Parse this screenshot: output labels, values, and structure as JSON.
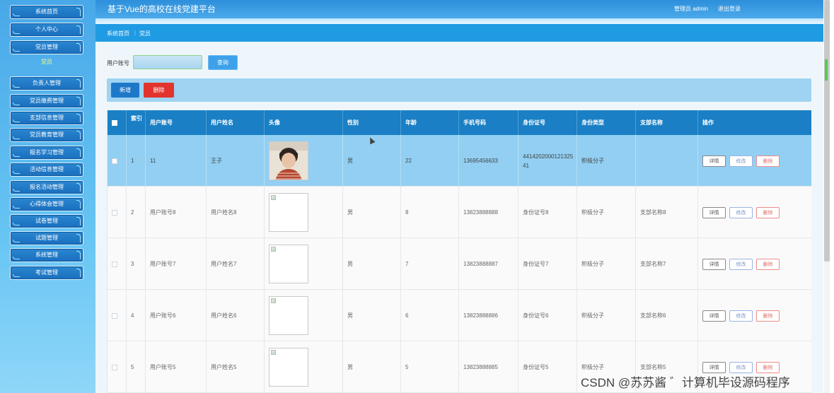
{
  "app": {
    "title": "基于Vue的高校在线党建平台"
  },
  "header": {
    "user_label": "管理员 admin",
    "logout_label": "退出登录"
  },
  "sidebar": {
    "items": [
      "系统首页",
      "个人中心",
      "党员管理",
      "负责人管理",
      "党员缴费管理",
      "支部信息管理",
      "党员教育管理",
      "报名学习管理",
      "活动信息管理",
      "报名活动管理",
      "心得体会管理",
      "试卷管理",
      "试题管理",
      "系统管理",
      "考试管理"
    ],
    "sub_item": "党员"
  },
  "breadcrumb": {
    "home": "系统首页",
    "separator": "⋮",
    "current": "党员"
  },
  "search": {
    "label": "用户账号",
    "value": "",
    "query_label": "查询"
  },
  "actions": {
    "add_label": "新增",
    "delete_label": "删除"
  },
  "table": {
    "columns": [
      "索引",
      "用户账号",
      "用户姓名",
      "头像",
      "性别",
      "年龄",
      "手机号码",
      "身份证号",
      "身份类型",
      "支部名称",
      "操作"
    ],
    "buttons": {
      "detail": "详情",
      "edit": "修改",
      "remove": "删除"
    },
    "rows": [
      {
        "index": "1",
        "account": "11",
        "name": "王子",
        "avatar": "photo",
        "gender": "男",
        "age": "22",
        "phone": "13695456633",
        "id_card": "441420200012132541",
        "type": "积极分子",
        "branch": ""
      },
      {
        "index": "2",
        "account": "用户账号8",
        "name": "用户姓名8",
        "avatar": "broken",
        "gender": "男",
        "age": "8",
        "phone": "13823888888",
        "id_card": "身份证号8",
        "type": "积极分子",
        "branch": "支部名称8"
      },
      {
        "index": "3",
        "account": "用户账号7",
        "name": "用户姓名7",
        "avatar": "broken",
        "gender": "男",
        "age": "7",
        "phone": "13823888887",
        "id_card": "身份证号7",
        "type": "积极分子",
        "branch": "支部名称7"
      },
      {
        "index": "4",
        "account": "用户账号6",
        "name": "用户姓名6",
        "avatar": "broken",
        "gender": "男",
        "age": "6",
        "phone": "13823888886",
        "id_card": "身份证号6",
        "type": "积极分子",
        "branch": "支部名称6"
      },
      {
        "index": "5",
        "account": "用户账号5",
        "name": "用户姓名5",
        "avatar": "broken",
        "gender": "男",
        "age": "5",
        "phone": "13823888885",
        "id_card": "身份证号5",
        "type": "积极分子",
        "branch": "支部名称5"
      }
    ]
  },
  "watermark": "CSDN @苏苏酱  ゛计算机毕设源码程序",
  "colors": {
    "primary": "#1a7fc4",
    "danger": "#e2342d",
    "selected_row": "#92cff2"
  }
}
